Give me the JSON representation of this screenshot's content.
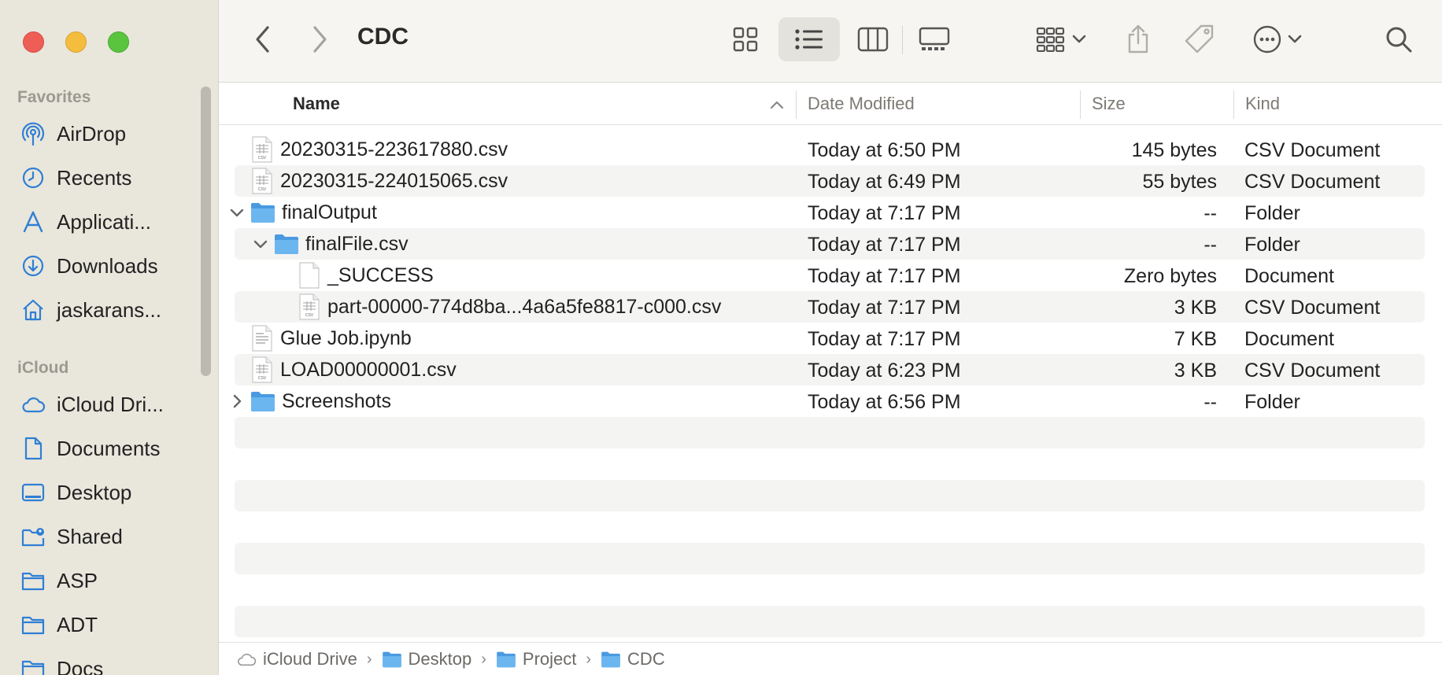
{
  "window": {
    "title": "CDC"
  },
  "sidebar": {
    "favorites_label": "Favorites",
    "favorites": [
      {
        "label": "AirDrop",
        "icon": "airdrop-icon"
      },
      {
        "label": "Recents",
        "icon": "clock-icon"
      },
      {
        "label": "Applicati...",
        "icon": "applications-icon"
      },
      {
        "label": "Downloads",
        "icon": "download-icon"
      },
      {
        "label": "jaskarans...",
        "icon": "home-icon"
      }
    ],
    "icloud_label": "iCloud",
    "icloud": [
      {
        "label": "iCloud Dri...",
        "icon": "cloud-icon"
      },
      {
        "label": "Documents",
        "icon": "document-icon"
      },
      {
        "label": "Desktop",
        "icon": "desktop-icon"
      },
      {
        "label": "Shared",
        "icon": "shared-folder-icon"
      },
      {
        "label": "ASP",
        "icon": "folder-icon"
      },
      {
        "label": "ADT",
        "icon": "folder-icon"
      },
      {
        "label": "Docs",
        "icon": "folder-icon"
      }
    ]
  },
  "columns": {
    "name": "Name",
    "date": "Date Modified",
    "size": "Size",
    "kind": "Kind"
  },
  "files": [
    {
      "name": "20230315-223617880.csv",
      "date": "Today at 6:50 PM",
      "size": "145 bytes",
      "kind": "CSV Document",
      "type": "csv",
      "indent": 0,
      "disclosure": ""
    },
    {
      "name": "20230315-224015065.csv",
      "date": "Today at 6:49 PM",
      "size": "55 bytes",
      "kind": "CSV Document",
      "type": "csv",
      "indent": 0,
      "disclosure": ""
    },
    {
      "name": "finalOutput",
      "date": "Today at 7:17 PM",
      "size": "--",
      "kind": "Folder",
      "type": "folder",
      "indent": 0,
      "disclosure": "open"
    },
    {
      "name": "finalFile.csv",
      "date": "Today at 7:17 PM",
      "size": "--",
      "kind": "Folder",
      "type": "folder",
      "indent": 1,
      "disclosure": "open"
    },
    {
      "name": "_SUCCESS",
      "date": "Today at 7:17 PM",
      "size": "Zero bytes",
      "kind": "Document",
      "type": "blank",
      "indent": 2,
      "disclosure": ""
    },
    {
      "name": "part-00000-774d8ba...4a6a5fe8817-c000.csv",
      "date": "Today at 7:17 PM",
      "size": "3 KB",
      "kind": "CSV Document",
      "type": "csv",
      "indent": 2,
      "disclosure": ""
    },
    {
      "name": "Glue Job.ipynb",
      "date": "Today at 7:17 PM",
      "size": "7 KB",
      "kind": "Document",
      "type": "text",
      "indent": 0,
      "disclosure": ""
    },
    {
      "name": "LOAD00000001.csv",
      "date": "Today at 6:23 PM",
      "size": "3 KB",
      "kind": "CSV Document",
      "type": "csv",
      "indent": 0,
      "disclosure": ""
    },
    {
      "name": "Screenshots",
      "date": "Today at 6:56 PM",
      "size": "--",
      "kind": "Folder",
      "type": "folder",
      "indent": 0,
      "disclosure": "closed"
    }
  ],
  "pathbar": [
    {
      "label": "iCloud Drive",
      "icon": "cloud-icon"
    },
    {
      "label": "Desktop",
      "icon": "folder-icon"
    },
    {
      "label": "Project",
      "icon": "folder-icon"
    },
    {
      "label": "CDC",
      "icon": "folder-icon"
    }
  ],
  "colors": {
    "folder": "#5aa9e6",
    "accent": "#2f7fd4",
    "sidebar_bg": "#e9e6dc"
  }
}
